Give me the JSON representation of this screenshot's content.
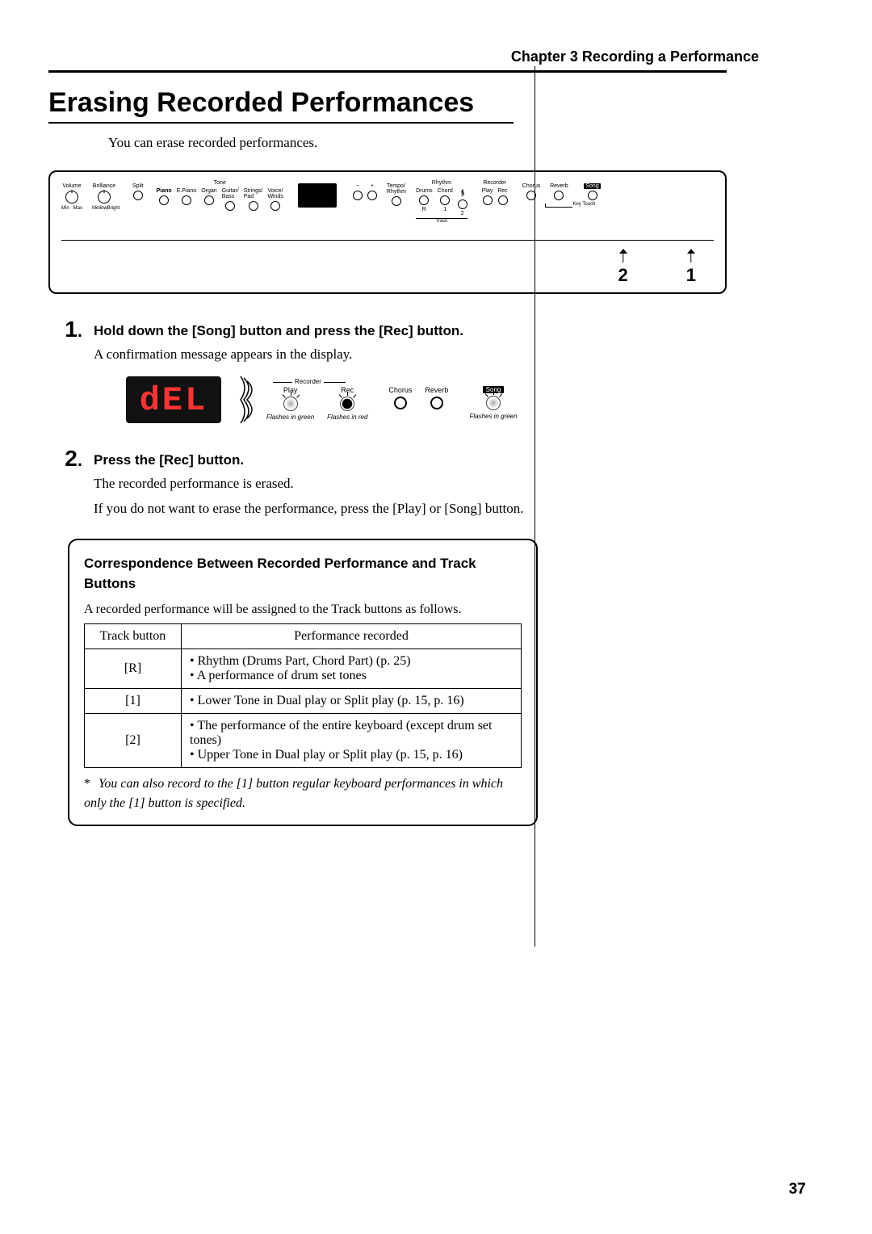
{
  "chapter_header": "Chapter 3 Recording a Performance",
  "section_title": "Erasing Recorded Performances",
  "intro": "You can erase recorded performances.",
  "panel": {
    "volume": "Volume",
    "brilliance": "Brilliance",
    "vol_min": "Min",
    "vol_max": "Max",
    "bri_mellow": "Mellow",
    "bri_bright": "Bright",
    "split": "Split",
    "tone_label": "Tone",
    "tones": [
      "Piano",
      "E.Piano",
      "Organ",
      "Guitar/\nBass",
      "Strings/\nPad",
      "Voice/\nWinds"
    ],
    "minus": "−",
    "plus": "+",
    "tempo": "Tempo/\nRhythm",
    "rhythm_label": "Rhythm",
    "drums": "Drums",
    "chord": "Chord",
    "metronome_icon": "metronome",
    "recorder_label": "Recorder",
    "play": "Play",
    "rec": "Rec",
    "chorus": "Chorus",
    "reverb": "Reverb",
    "song": "Song",
    "key_touch": "Key Touch",
    "track_label": "Track",
    "track_r": "R",
    "track_1": "1",
    "track_2": "2",
    "callout_1": "2",
    "callout_2": "1"
  },
  "step1": {
    "num": "1",
    "dot": ".",
    "head": "Hold down the [Song] button and press the [Rec] button.",
    "text": "A confirmation message appears in the display."
  },
  "del_diagram": {
    "display_text": "dEL",
    "recorder_label": "Recorder",
    "play": "Play",
    "rec": "Rec",
    "chorus": "Chorus",
    "reverb": "Reverb",
    "song": "Song",
    "flash_green": "Flashes in green",
    "flash_red": "Flashes in red"
  },
  "step2": {
    "num": "2",
    "dot": ".",
    "head": "Press the [Rec] button.",
    "text1": "The recorded performance is erased.",
    "text2": "If you do not want to erase the performance, press the [Play] or [Song] button."
  },
  "inset": {
    "title": "Correspondence Between Recorded Performance and Track Buttons",
    "intro": "A recorded performance will be assigned to the Track buttons as follows.",
    "table": {
      "header": [
        "Track button",
        "Performance recorded"
      ],
      "rows": [
        {
          "btn": "[R]",
          "desc": "• Rhythm (Drums Part, Chord Part) (p. 25)\n• A performance of drum set tones"
        },
        {
          "btn": "[1]",
          "desc": "• Lower Tone in Dual play or Split play (p. 15, p. 16)"
        },
        {
          "btn": "[2]",
          "desc": "• The performance of the entire keyboard (except drum set tones)\n• Upper Tone in Dual play or Split play (p. 15, p. 16)"
        }
      ]
    },
    "footnote_star": "*",
    "footnote": "You can also record to the [1] button regular keyboard performances in which only the [1] button is specified."
  },
  "page_number": "37"
}
